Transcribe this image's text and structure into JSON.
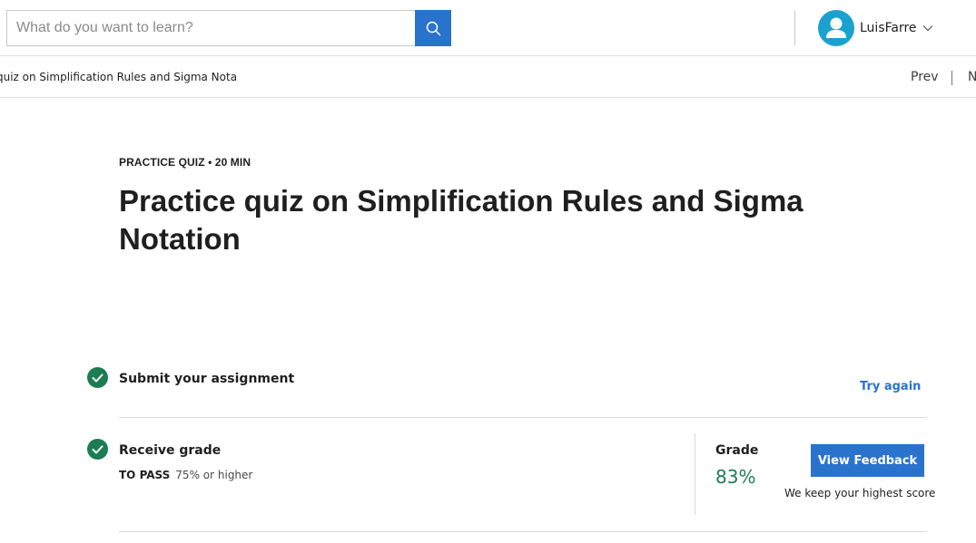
{
  "search": {
    "placeholder": "What do you want to learn?"
  },
  "user": {
    "name": "LuisFarre"
  },
  "breadcrumb": {
    "text": "quiz on Simplification Rules and Sigma Notati"
  },
  "nav": {
    "prev_label": "Prev",
    "next_label": "N"
  },
  "quiz": {
    "meta": "PRACTICE QUIZ • 20 MIN",
    "title": "Practice quiz on Simplification Rules and Sigma Notation"
  },
  "steps": {
    "submit": {
      "label": "Submit your assignment",
      "action": "Try again"
    },
    "grade": {
      "label": "Receive grade",
      "to_pass_label": "TO PASS",
      "to_pass_value": "75% or higher",
      "grade_label": "Grade",
      "grade_value": "83%",
      "feedback_button": "View Feedback",
      "note": "We keep your highest score"
    }
  },
  "colors": {
    "accent": "#2a73cc",
    "success": "#1c7c54",
    "avatar": "#1ba1cf"
  },
  "icons": [
    "search-icon",
    "user-icon",
    "chevron-down-icon",
    "check-icon"
  ]
}
